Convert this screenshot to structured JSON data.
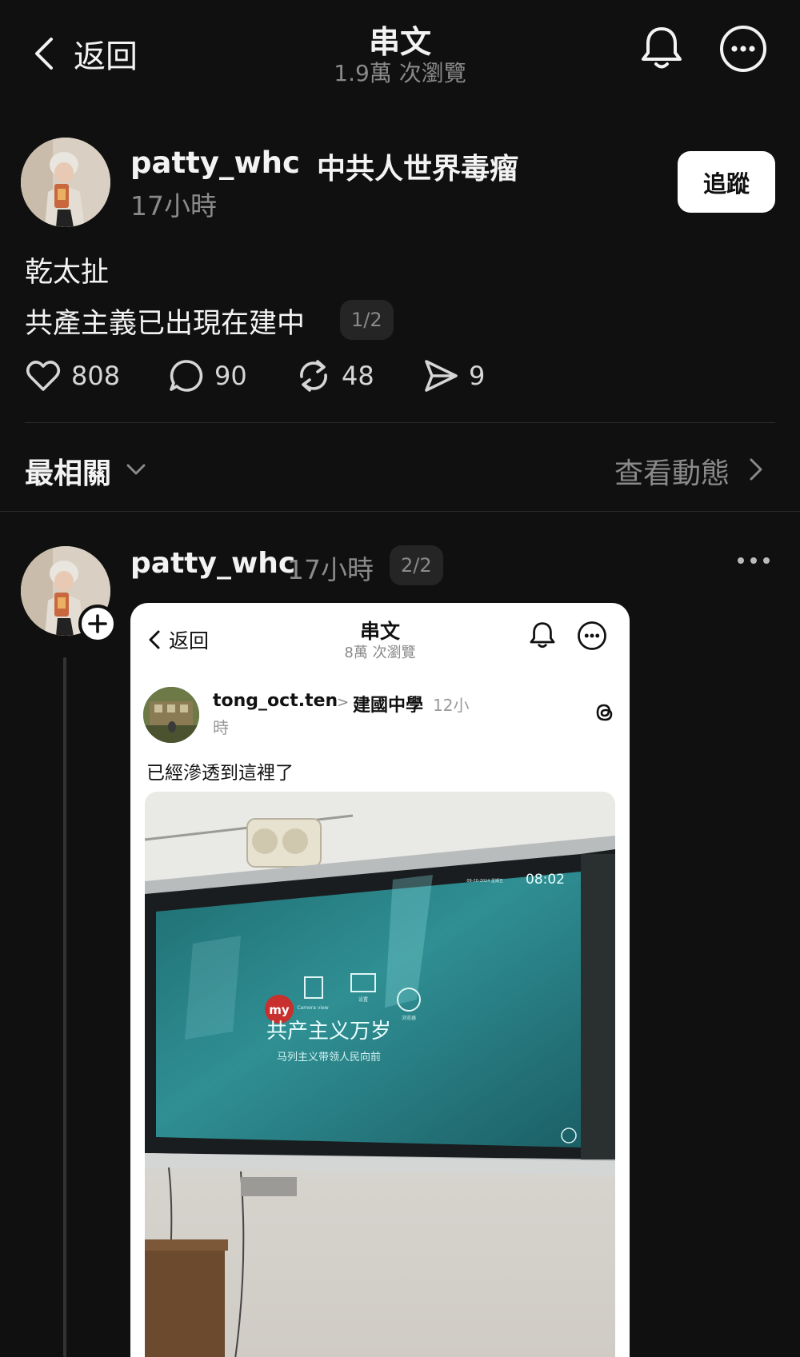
{
  "header": {
    "back_label": "返回",
    "title": "串文",
    "views": "1.9萬 次瀏覽"
  },
  "post": {
    "username": "patty_whc",
    "topic": "中共人世界毒瘤",
    "time": "17小時",
    "follow_label": "追蹤",
    "text_line1": "乾太扯",
    "text_line2": "共產主義已出現在建中",
    "pager": "1/2",
    "stats": {
      "likes": "808",
      "comments": "90",
      "reposts": "48",
      "shares": "9"
    }
  },
  "sort": {
    "label": "最相關",
    "activity_label": "查看動態"
  },
  "reply": {
    "username": "patty_whc",
    "time": "17小時",
    "pager": "2/2"
  },
  "embed": {
    "back_label": "返回",
    "title": "串文",
    "views": "8萬 次瀏覽",
    "username": "tong_oct.ten",
    "arrow": ">",
    "topic": "建國中學",
    "time_line1": "12小",
    "time_line2": "時",
    "text": "已經滲透到這裡了",
    "screen_clock": "08:02",
    "screen_date": "09-20-2024 星期五",
    "screen_logo": "my",
    "screen_headline": "共产主义万岁",
    "screen_subline": "马列主义带领人民向前",
    "screen_icon_labels": [
      "Camera view",
      "设置",
      "浏览器"
    ]
  }
}
